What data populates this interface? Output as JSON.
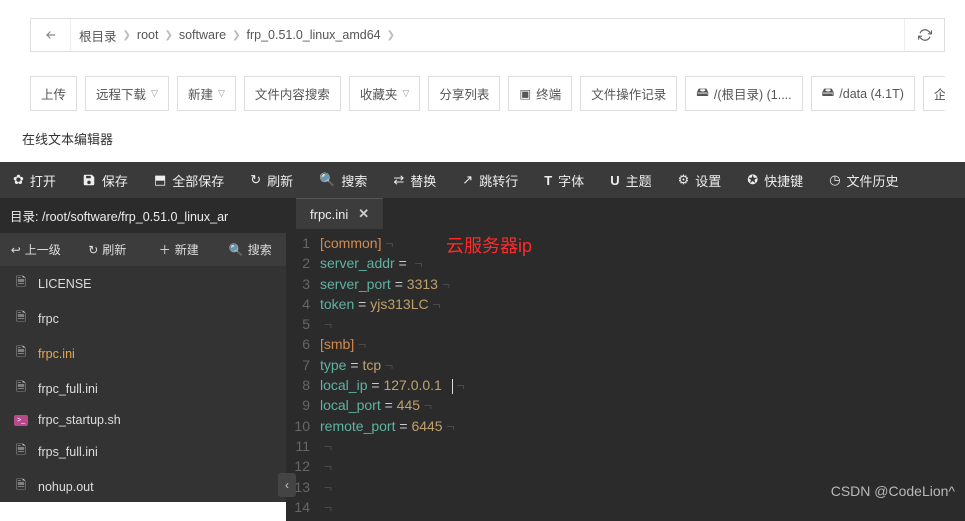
{
  "breadcrumb": {
    "segments": [
      "根目录",
      "root",
      "software",
      "frp_0.51.0_linux_amd64"
    ]
  },
  "toolbar": {
    "upload": "上传",
    "remote_dl": "远程下载",
    "new": "新建",
    "content_search": "文件内容搜索",
    "fav": "收藏夹",
    "share_list": "分享列表",
    "terminal": "终端",
    "op_log": "文件操作记录",
    "disk_root": "/(根目录) (1....",
    "disk_data": "/data (4.1T)",
    "enterprise": "企业级防篡改"
  },
  "editor_title": "在线文本编辑器",
  "menu": {
    "open": "打开",
    "save": "保存",
    "save_all": "全部保存",
    "refresh": "刷新",
    "search": "搜索",
    "replace": "替换",
    "goto": "跳转行",
    "font": "字体",
    "theme": "主题",
    "settings": "设置",
    "shortcuts": "快捷键",
    "history": "文件历史"
  },
  "sidebar": {
    "path_label": "目录:",
    "path": "/root/software/frp_0.51.0_linux_ar",
    "ops": {
      "up": "上一级",
      "refresh": "刷新",
      "new": "新建",
      "search": "搜索"
    },
    "files": [
      "LICENSE",
      "frpc",
      "frpc.ini",
      "frpc_full.ini",
      "frpc_startup.sh",
      "frps_full.ini",
      "nohup.out"
    ],
    "active": "frpc.ini"
  },
  "tab": {
    "name": "frpc.ini"
  },
  "code_lines": [
    {
      "n": 1,
      "seg": [
        {
          "c": "k-orange",
          "t": "[common]"
        }
      ]
    },
    {
      "n": 2,
      "seg": [
        {
          "c": "k-teal",
          "t": "server_addr"
        },
        {
          "c": "",
          "t": " = "
        }
      ]
    },
    {
      "n": 3,
      "seg": [
        {
          "c": "k-teal",
          "t": "server_port"
        },
        {
          "c": "",
          "t": " = "
        },
        {
          "c": "k-str",
          "t": "3313"
        }
      ]
    },
    {
      "n": 4,
      "seg": [
        {
          "c": "k-teal",
          "t": "token"
        },
        {
          "c": "",
          "t": " = "
        },
        {
          "c": "k-str",
          "t": "yjs313LC"
        }
      ]
    },
    {
      "n": 5,
      "seg": []
    },
    {
      "n": 6,
      "seg": [
        {
          "c": "k-orange",
          "t": "[smb]"
        }
      ]
    },
    {
      "n": 7,
      "seg": [
        {
          "c": "k-teal",
          "t": "type"
        },
        {
          "c": "",
          "t": " = "
        },
        {
          "c": "k-str",
          "t": "tcp"
        }
      ]
    },
    {
      "n": 8,
      "seg": [
        {
          "c": "k-teal",
          "t": "local_ip"
        },
        {
          "c": "",
          "t": " = "
        },
        {
          "c": "k-str",
          "t": "127.0.0.1"
        }
      ],
      "cursor": true
    },
    {
      "n": 9,
      "seg": [
        {
          "c": "k-teal",
          "t": "local_port"
        },
        {
          "c": "",
          "t": " = "
        },
        {
          "c": "k-str",
          "t": "445"
        }
      ]
    },
    {
      "n": 10,
      "seg": [
        {
          "c": "k-teal",
          "t": "remote_port"
        },
        {
          "c": "",
          "t": " = "
        },
        {
          "c": "k-str",
          "t": "6445"
        }
      ]
    },
    {
      "n": 11,
      "seg": []
    },
    {
      "n": 12,
      "seg": []
    },
    {
      "n": 13,
      "seg": []
    },
    {
      "n": 14,
      "seg": []
    }
  ],
  "annotation": "云服务器ip",
  "watermark": "CSDN @CodeLion^"
}
